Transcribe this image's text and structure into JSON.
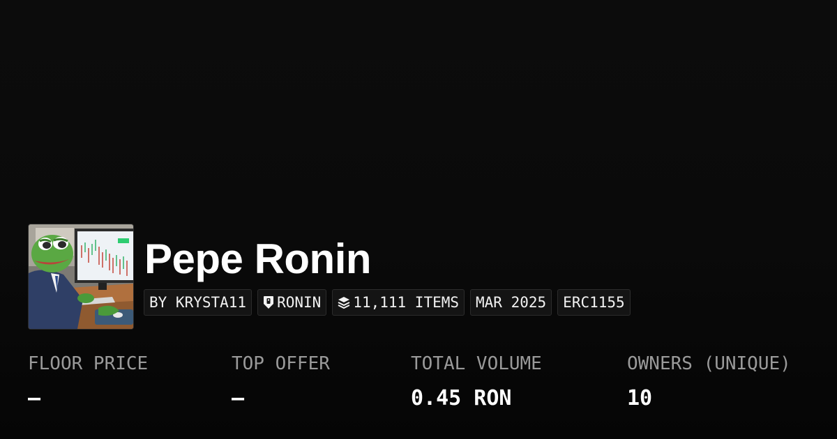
{
  "collection": {
    "name": "Pepe Ronin",
    "thumbnail_icon": "pepe-trader-avatar"
  },
  "tags": [
    {
      "label": "BY KRYSTA11",
      "icon": null
    },
    {
      "label": "RONIN",
      "icon": "ronin-shield-icon"
    },
    {
      "label": "11,111 ITEMS",
      "icon": "layers-icon"
    },
    {
      "label": "MAR 2025",
      "icon": null
    },
    {
      "label": "ERC1155",
      "icon": null
    }
  ],
  "stats": [
    {
      "label": "FLOOR PRICE",
      "value": "–"
    },
    {
      "label": "TOP OFFER",
      "value": "–"
    },
    {
      "label": "TOTAL VOLUME",
      "value": "0.45 RON"
    },
    {
      "label": "OWNERS (UNIQUE)",
      "value": "10"
    }
  ],
  "colors": {
    "background": "#0a0a0a",
    "tag_background": "#141414",
    "tag_border": "#2c2c2c",
    "label_gray": "#9a9a9a",
    "text_white": "#ffffff"
  }
}
